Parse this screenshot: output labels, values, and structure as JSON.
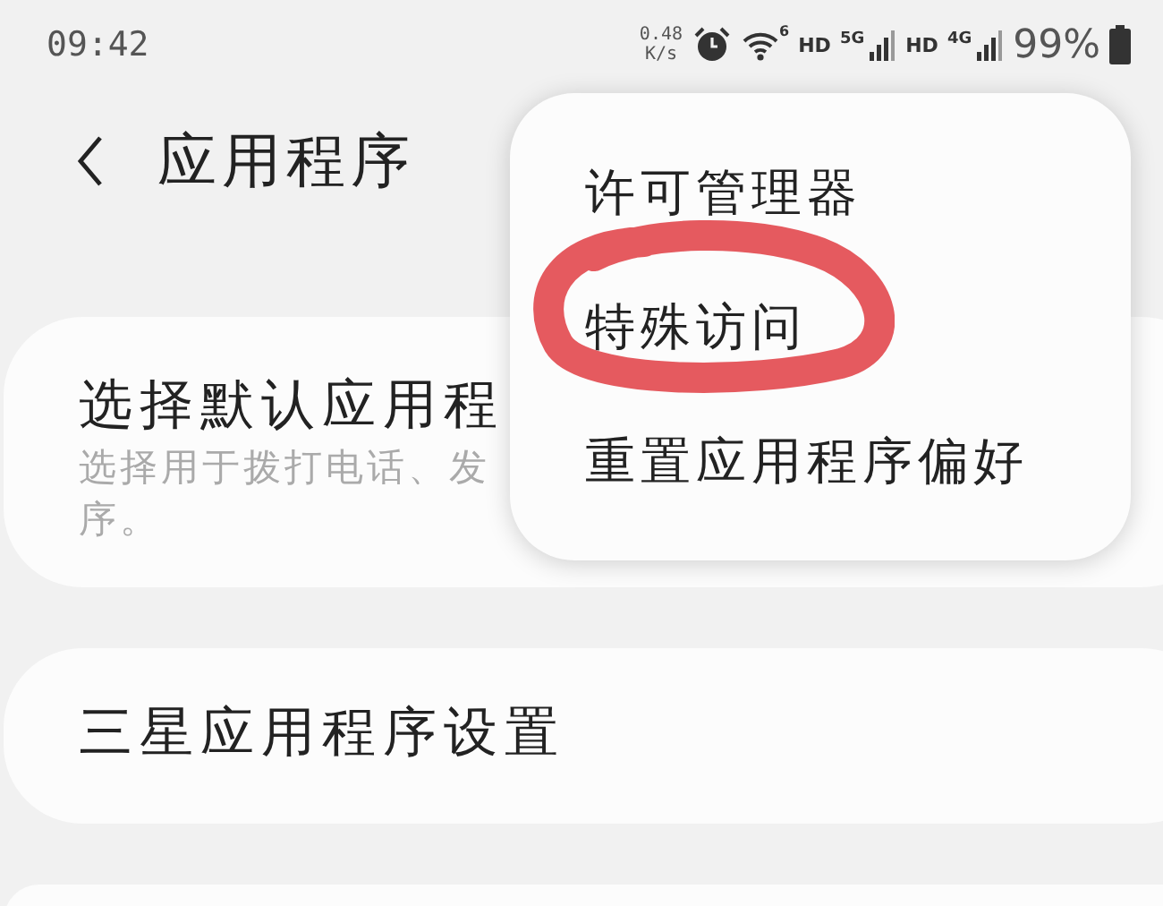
{
  "status_bar": {
    "time": "09:42",
    "speed_value": "0.48",
    "speed_unit": "K/s",
    "wifi_label": "6",
    "network_labels": [
      "HD",
      "5G",
      "HD",
      "4G"
    ],
    "battery": "99%"
  },
  "header": {
    "title": "应用程序"
  },
  "cards": [
    {
      "title": "选择默认应用程",
      "subtitle_lines": [
        "选择用于拨打电话、发",
        "序。"
      ]
    },
    {
      "title": "三星应用程序设置"
    }
  ],
  "menu": {
    "items": [
      {
        "label": "许可管理器",
        "annotated": false
      },
      {
        "label": "特殊访问",
        "annotated": true
      },
      {
        "label": "重置应用程序偏好",
        "annotated": false
      }
    ]
  }
}
